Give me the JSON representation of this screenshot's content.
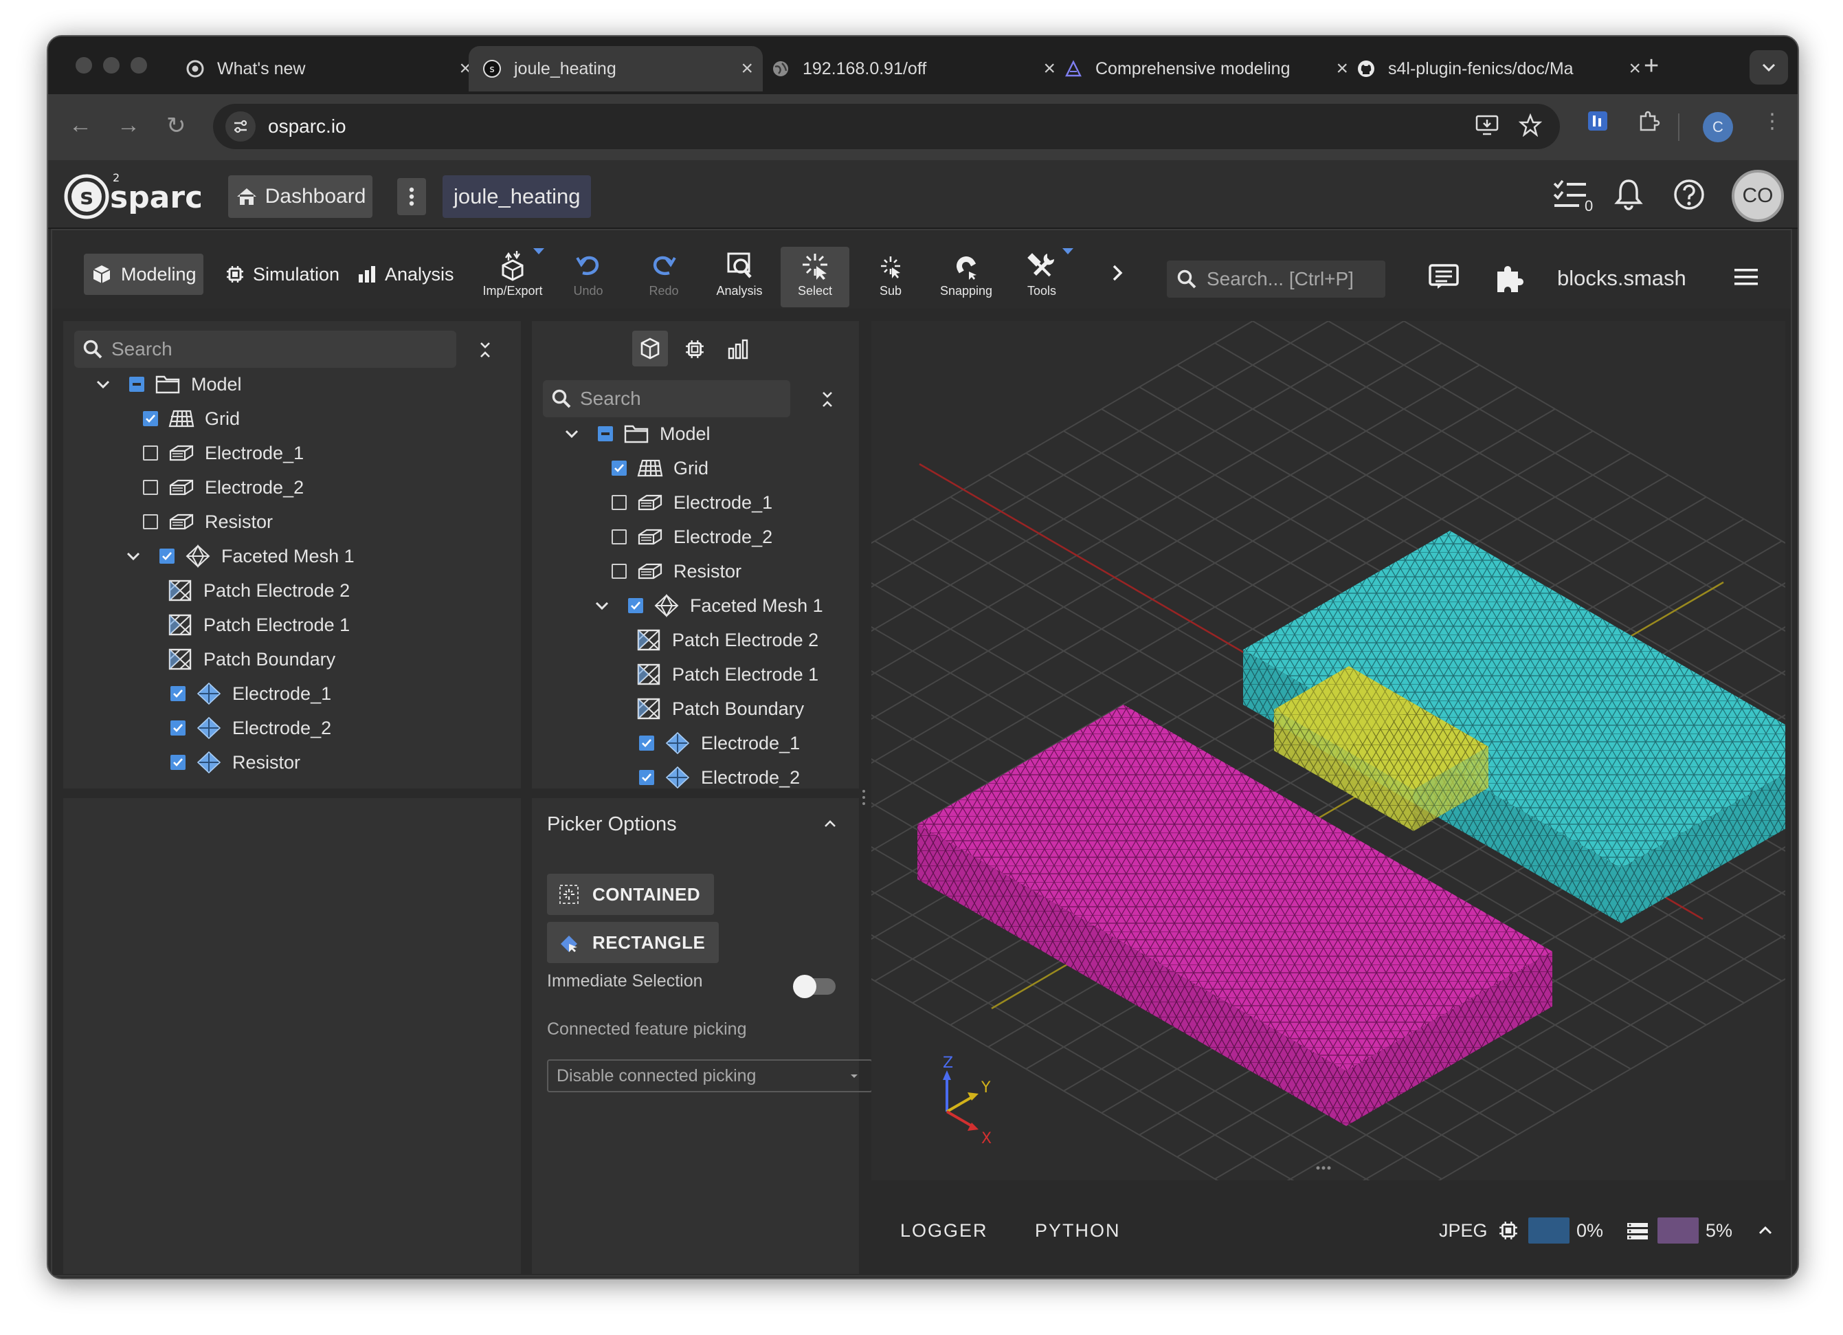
{
  "browser": {
    "tabs": [
      {
        "title": "What's new",
        "icon": "chrome-icon"
      },
      {
        "title": "joule_heating",
        "icon": "osparc-favicon",
        "active": true
      },
      {
        "title": "192.168.0.91/off",
        "icon": "globe-icon"
      },
      {
        "title": "Comprehensive modeling",
        "icon": "itis-favicon"
      },
      {
        "title": "s4l-plugin-fenics/doc/Ma",
        "icon": "github-icon"
      }
    ],
    "url": "osparc.io",
    "profile_initial": "C"
  },
  "header": {
    "logo_text": "sparc",
    "dashboard_label": "Dashboard",
    "study_name": "joule_heating",
    "tasks_count": "0",
    "avatar_initials": "CO"
  },
  "toolbar": {
    "modes": [
      {
        "label": "Modeling",
        "active": true
      },
      {
        "label": "Simulation"
      },
      {
        "label": "Analysis"
      }
    ],
    "tools": [
      {
        "label": "Imp/Export",
        "icon": "import-export-icon",
        "dropdown": true
      },
      {
        "label": "Undo",
        "icon": "undo-icon",
        "disabled": true
      },
      {
        "label": "Redo",
        "icon": "redo-icon",
        "disabled": true
      },
      {
        "label": "Analysis",
        "icon": "analysis-icon"
      },
      {
        "label": "Select",
        "icon": "select-icon",
        "active": true
      },
      {
        "label": "Sub",
        "icon": "sub-icon"
      },
      {
        "label": "Snapping",
        "icon": "snapping-icon"
      },
      {
        "label": "Tools",
        "icon": "tools-icon",
        "dropdown": true
      }
    ],
    "search_placeholder": "Search... [Ctrl+P]",
    "project_file": "blocks.smash"
  },
  "left_tree": {
    "search_placeholder": "Search",
    "rows": [
      {
        "label": "Model",
        "icon": "folder-icon",
        "check": "partial",
        "expanded": true
      },
      {
        "label": "Grid",
        "icon": "grid-icon",
        "check": "checked"
      },
      {
        "label": "Electrode_1",
        "icon": "solid-block-icon",
        "check": "unchecked"
      },
      {
        "label": "Electrode_2",
        "icon": "solid-block-icon",
        "check": "unchecked"
      },
      {
        "label": "Resistor",
        "icon": "solid-block-icon",
        "check": "unchecked"
      },
      {
        "label": "Faceted Mesh 1",
        "icon": "mesh-icon",
        "check": "checked",
        "expanded": true
      },
      {
        "label": "Patch Electrode 2",
        "icon": "patch-icon"
      },
      {
        "label": "Patch Electrode 1",
        "icon": "patch-icon"
      },
      {
        "label": "Patch Boundary",
        "icon": "patch-icon"
      },
      {
        "label": "Electrode_1",
        "icon": "volume-icon",
        "check": "checked"
      },
      {
        "label": "Electrode_2",
        "icon": "volume-icon",
        "check": "checked"
      },
      {
        "label": "Resistor",
        "icon": "volume-icon",
        "check": "checked"
      }
    ]
  },
  "mid_tree": {
    "search_placeholder": "Search",
    "rows": [
      {
        "label": "Model",
        "icon": "folder-icon",
        "check": "partial",
        "expanded": true
      },
      {
        "label": "Grid",
        "icon": "grid-icon",
        "check": "checked"
      },
      {
        "label": "Electrode_1",
        "icon": "solid-block-icon",
        "check": "unchecked"
      },
      {
        "label": "Electrode_2",
        "icon": "solid-block-icon",
        "check": "unchecked"
      },
      {
        "label": "Resistor",
        "icon": "solid-block-icon",
        "check": "unchecked"
      },
      {
        "label": "Faceted Mesh 1",
        "icon": "mesh-icon",
        "check": "checked",
        "expanded": true
      },
      {
        "label": "Patch Electrode 2",
        "icon": "patch-icon"
      },
      {
        "label": "Patch Electrode 1",
        "icon": "patch-icon"
      },
      {
        "label": "Patch Boundary",
        "icon": "patch-icon"
      },
      {
        "label": "Electrode_1",
        "icon": "volume-icon",
        "check": "checked"
      },
      {
        "label": "Electrode_2",
        "icon": "volume-icon",
        "check": "checked"
      }
    ]
  },
  "picker": {
    "title": "Picker Options",
    "contained_label": "CONTAINED",
    "rectangle_label": "RECTANGLE",
    "immediate_selection_label": "Immediate Selection",
    "immediate_selection_on": false,
    "connected_label": "Connected feature picking",
    "connected_value": "Disable connected picking"
  },
  "viewport": {
    "axes": {
      "z": "Z",
      "y": "Y",
      "x": "X"
    },
    "colors": {
      "electrode_1": "#cf2fa9",
      "electrode_2": "#3ec6c9",
      "resistor": "#c9cf3a",
      "grid": "#4a4a4a"
    }
  },
  "bottom": {
    "logger_label": "LOGGER",
    "python_label": "PYTHON",
    "image_format": "JPEG",
    "cpu_value": "0%",
    "mem_value": "5%"
  }
}
